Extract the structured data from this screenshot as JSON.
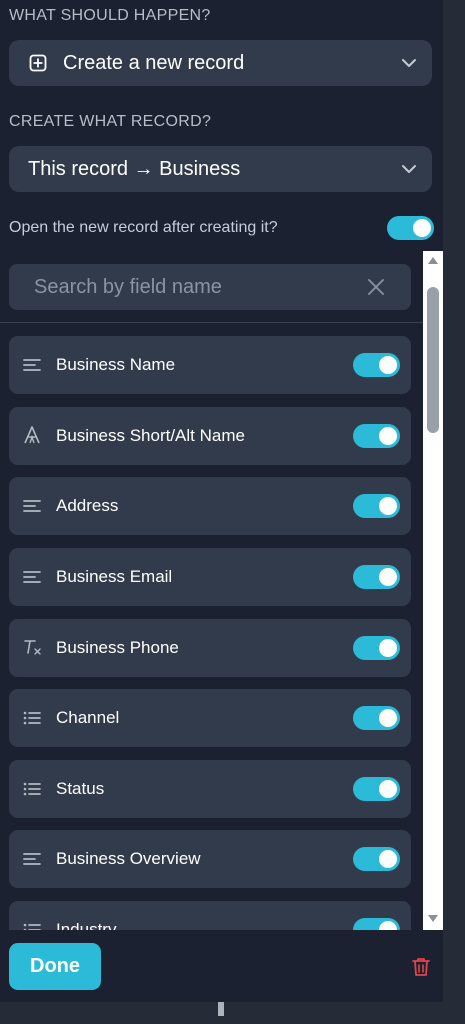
{
  "action": {
    "section_label": "WHAT SHOULD HAPPEN?",
    "selected": "Create a new record",
    "icon": "plus-square-icon"
  },
  "target": {
    "section_label": "CREATE WHAT RECORD?",
    "selected": "This record → Business"
  },
  "open_after": {
    "label": "Open the new record after creating it?",
    "enabled": true
  },
  "search": {
    "placeholder": "Search by field name"
  },
  "fields": [
    {
      "label": "Business Name",
      "icon": "long-text-icon",
      "enabled": true
    },
    {
      "label": "Business Short/Alt Name",
      "icon": "font-letter-icon",
      "enabled": true
    },
    {
      "label": "Address",
      "icon": "long-text-icon",
      "enabled": true
    },
    {
      "label": "Business Email",
      "icon": "long-text-icon",
      "enabled": true
    },
    {
      "label": "Business Phone",
      "icon": "formula-icon",
      "enabled": true
    },
    {
      "label": "Channel",
      "icon": "list-icon",
      "enabled": true
    },
    {
      "label": "Status",
      "icon": "list-icon",
      "enabled": true
    },
    {
      "label": "Business Overview",
      "icon": "long-text-icon",
      "enabled": true
    },
    {
      "label": "Industry",
      "icon": "list-icon",
      "enabled": true
    }
  ],
  "footer": {
    "done_label": "Done",
    "delete_icon": "trash-icon"
  },
  "colors": {
    "accent": "#2bbbd8",
    "panel": "#1b2130",
    "card": "#323b4c",
    "danger": "#e0444b"
  }
}
